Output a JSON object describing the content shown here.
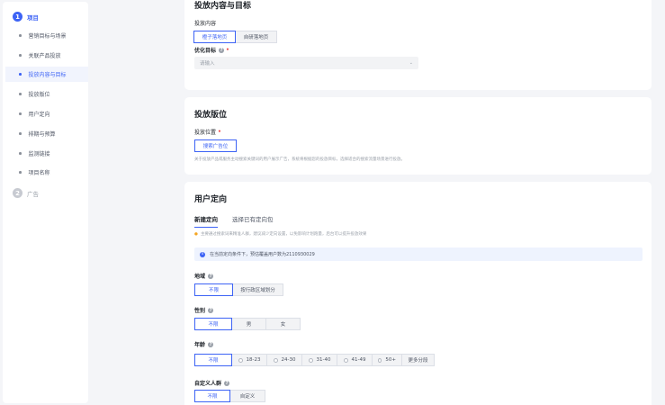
{
  "sidebar": {
    "step1": {
      "num": "1",
      "label": "项目"
    },
    "items": [
      {
        "label": "营销目标与场景"
      },
      {
        "label": "关联产品投放"
      },
      {
        "label": "投放内容与目标"
      },
      {
        "label": "投放版位"
      },
      {
        "label": "用户定向"
      },
      {
        "label": "排期与预算"
      },
      {
        "label": "监测链接"
      },
      {
        "label": "项目名称"
      }
    ],
    "step2": {
      "num": "2",
      "label": "广告"
    }
  },
  "content_section": {
    "title": "投放内容与目标",
    "content_label": "投放内容",
    "content_options": [
      "橙子落地页",
      "自研落地页"
    ],
    "goal_label": "优化目标",
    "goal_placeholder": "请输入"
  },
  "placement_section": {
    "title": "投放版位",
    "position_label": "投放位置",
    "position_option": "搜索广告位",
    "hint": "关于投放产品或服务主动搜索关键词的用户展示广告，系统将根据您的投放目标，选择适合的搜索流量场景进行投放。"
  },
  "audience_section": {
    "title": "用户定向",
    "tabs": [
      "新建定向",
      "选择已有定向包"
    ],
    "hint": "主要通过搜索词来精准人群，建议减少定向设置，以免影响计划跑量，后台可以提升投放效果",
    "info": "在当前定向条件下，预估覆盖用户数为2110930029",
    "region_label": "地域",
    "region_options": [
      "不限",
      "按行政区域划分"
    ],
    "gender_label": "性别",
    "gender_options": [
      "不限",
      "男",
      "女"
    ],
    "age_label": "年龄",
    "age_options": [
      "不限",
      "18-23",
      "24-30",
      "31-40",
      "41-49",
      "50+",
      "更多分段"
    ],
    "custom_label": "自定义人群",
    "custom_options": [
      "不限",
      "自定义"
    ]
  }
}
